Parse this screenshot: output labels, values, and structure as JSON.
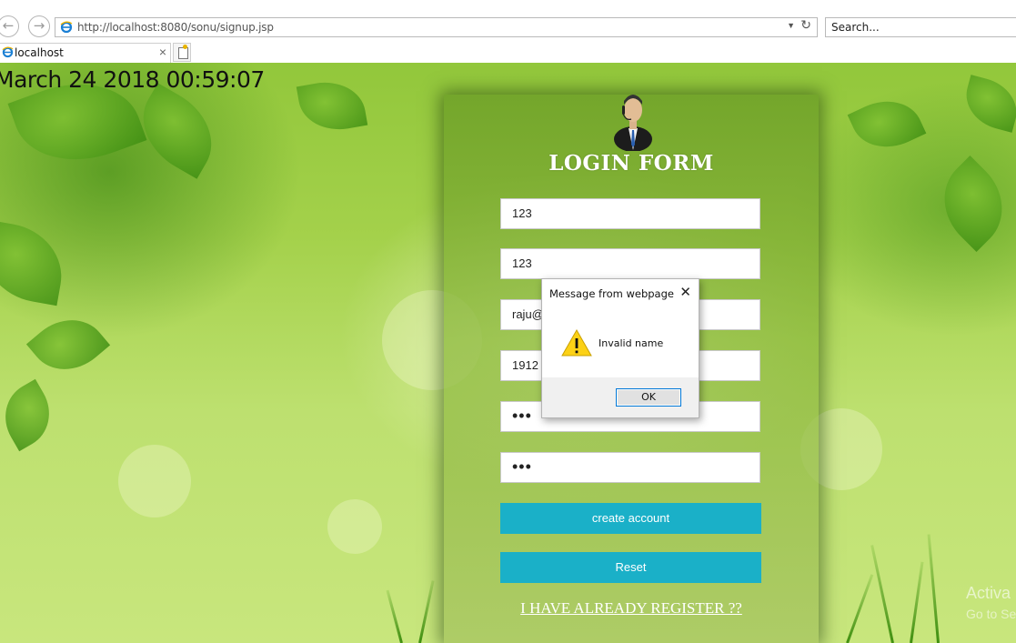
{
  "browser": {
    "back_icon": "arrow-left-icon",
    "forward_icon": "arrow-right-icon",
    "address": "http://localhost:8080/sonu/signup.jsp",
    "search_placeholder": "Search...",
    "tab_label": "localhost",
    "tab_close": "×",
    "refresh_icon": "refresh-icon"
  },
  "page": {
    "datetime": "March 24 2018 00:59:07",
    "form_title": "LOGIN FORM",
    "fields": {
      "field1": "123",
      "field2": "123",
      "field3": "raju@",
      "field4": "1912",
      "password1": "•••",
      "password2": "•••"
    },
    "create_account_label": "create account",
    "reset_label": "Reset",
    "register_link": "I HAVE ALREADY REGISTER ??"
  },
  "dialog": {
    "title": "Message from webpage",
    "message": "Invalid name",
    "ok_label": "OK",
    "close_glyph": "✕"
  },
  "watermark": {
    "line1": "Activa",
    "line2": "Go to Se"
  },
  "colors": {
    "button": "#1ab0c8",
    "dialog_focus": "#0078d7"
  }
}
